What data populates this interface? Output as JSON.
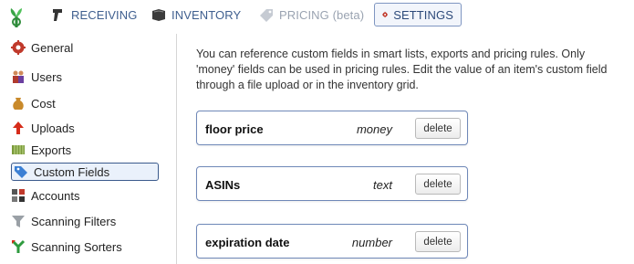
{
  "nav": {
    "tabs": [
      {
        "label": "RECEIVING",
        "icon": "scanner-icon"
      },
      {
        "label": "INVENTORY",
        "icon": "book-icon"
      },
      {
        "label": "PRICING (beta)",
        "icon": "price-tag-icon"
      },
      {
        "label": "SETTINGS",
        "icon": "gear-icon"
      }
    ],
    "active": "SETTINGS"
  },
  "sidebar": {
    "items": [
      {
        "label": "General",
        "icon": "gear-icon"
      },
      {
        "label": "Users",
        "icon": "users-icon"
      },
      {
        "label": "Cost",
        "icon": "money-bag-icon"
      },
      {
        "label": "Uploads",
        "icon": "upload-arrow-icon"
      },
      {
        "label": "Exports",
        "icon": "exports-icon"
      },
      {
        "label": "Custom Fields",
        "icon": "tag-icon"
      },
      {
        "label": "Accounts",
        "icon": "accounts-icon"
      },
      {
        "label": "Scanning Filters",
        "icon": "funnel-icon"
      },
      {
        "label": "Scanning Sorters",
        "icon": "sorter-icon"
      }
    ],
    "active": "Custom Fields"
  },
  "main": {
    "intro": "You can reference custom fields in smart lists, exports and pricing rules. Only 'money' fields can be used in pricing rules. Edit the value of an item's custom field through a file upload or in the inventory grid.",
    "fields": [
      {
        "name": "floor price",
        "type": "money",
        "action": "delete"
      },
      {
        "name": "ASINs",
        "type": "text",
        "action": "delete"
      },
      {
        "name": "expiration date",
        "type": "number",
        "action": "delete"
      }
    ]
  },
  "colors": {
    "nav_text": "#3f5f8f",
    "active_border": "#3b5a8c",
    "field_border": "#6f88b8"
  }
}
